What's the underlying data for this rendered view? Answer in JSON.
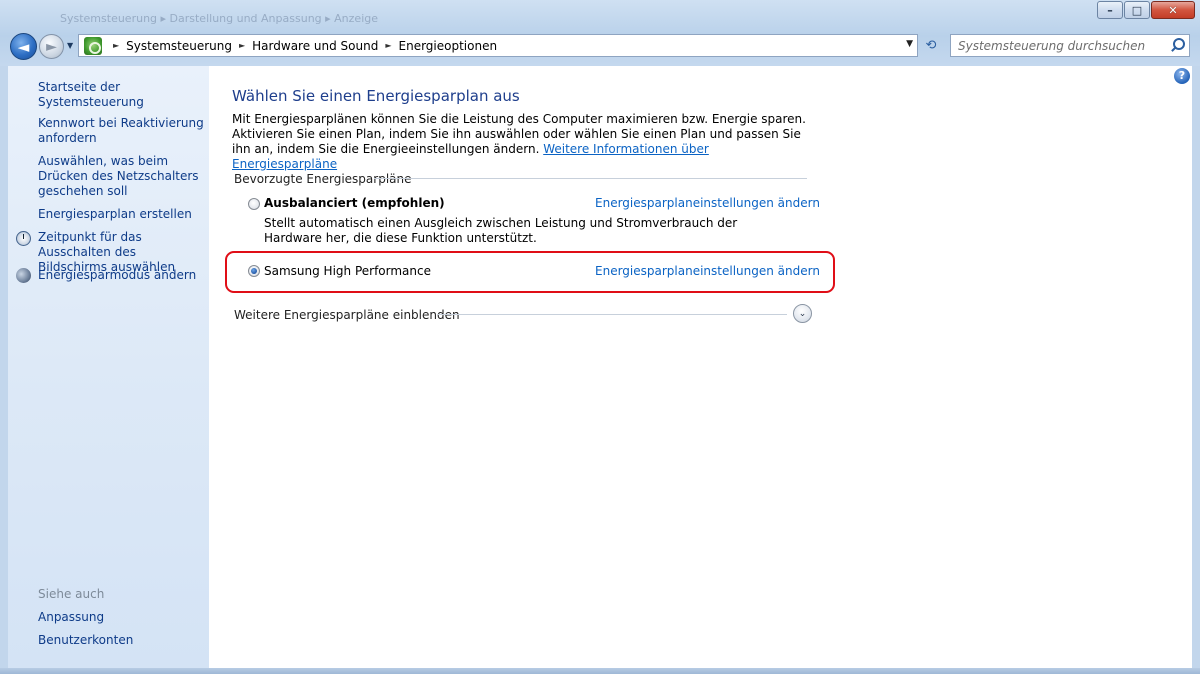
{
  "window": {
    "ghost_title": "Systemsteuerung ▸ Darstellung und Anpassung ▸ Anzeige",
    "minimize_glyph": "–",
    "maximize_glyph": "□",
    "close_glyph": "✕"
  },
  "nav": {
    "back_glyph": "◄",
    "forward_glyph": "►",
    "history_glyph": "▼",
    "breadcrumb": [
      "Systemsteuerung",
      "Hardware und Sound",
      "Energieoptionen"
    ],
    "separator_glyph": "►",
    "address_dropdown_glyph": "▼",
    "refresh_glyph": "⟲",
    "search_placeholder": "Systemsteuerung durchsuchen"
  },
  "sidebar": {
    "home": "Startseite der Systemsteuerung",
    "items": [
      {
        "label": "Kennwort bei Reaktivierung anfordern",
        "icon": ""
      },
      {
        "label": "Auswählen, was beim Drücken des Netzschalters geschehen soll",
        "icon": ""
      },
      {
        "label": "Energiesparplan erstellen",
        "icon": ""
      },
      {
        "label": "Zeitpunkt für das Ausschalten des Bildschirms auswählen",
        "icon": "clock-icon"
      },
      {
        "label": "Energiesparmodus ändern",
        "icon": "moon-icon"
      }
    ],
    "see_also": "Siehe auch",
    "see_also_links": [
      "Anpassung",
      "Benutzerkonten"
    ]
  },
  "main": {
    "help_glyph": "?",
    "title": "Wählen Sie einen Energiesparplan aus",
    "intro_text": "Mit Energiesparplänen können Sie die Leistung des Computer maximieren bzw. Energie sparen. Aktivieren Sie einen Plan, indem Sie ihn auswählen oder wählen Sie einen Plan und passen Sie ihn an, indem Sie die Energieeinstellungen ändern. ",
    "intro_link": "Weitere Informationen über Energiesparpläne",
    "preferred_heading": "Bevorzugte Energiesparpläne",
    "plans": [
      {
        "name": "Ausbalanciert (empfohlen)",
        "description": "Stellt automatisch einen Ausgleich zwischen Leistung und Stromverbrauch der Hardware her, die diese Funktion unterstützt.",
        "link": "Energiesparplaneinstellungen ändern",
        "selected": false
      },
      {
        "name": "Samsung High Performance",
        "description": "",
        "link": "Energiesparplaneinstellungen ändern",
        "selected": true
      }
    ],
    "more_plans_label": "Weitere Energiesparpläne einblenden",
    "expand_glyph": "⌄",
    "highlight_color": "#e00e17"
  }
}
